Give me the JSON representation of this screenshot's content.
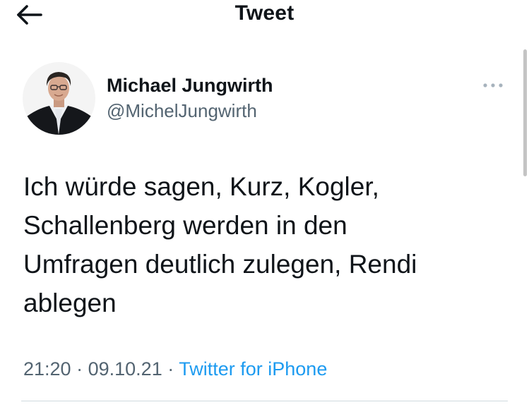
{
  "header": {
    "title": "Tweet",
    "back_icon": "arrow-left-icon"
  },
  "tweet": {
    "author": {
      "name": "Michael Jungwirth",
      "handle": "@MichelJungwirth"
    },
    "more_icon": "more-horizontal-icon",
    "text": "Ich würde sagen, Kurz, Kogler,\nSchallenberg werden in den\nUmfragen deutlich zulegen, Rendi\nablegen",
    "time": "21:20",
    "separator": "·",
    "date": "09.10.21",
    "source": "Twitter for iPhone"
  },
  "colors": {
    "text": "#0f1419",
    "secondary": "#536471",
    "link": "#1d9bf0",
    "divider": "#cfd9de"
  }
}
